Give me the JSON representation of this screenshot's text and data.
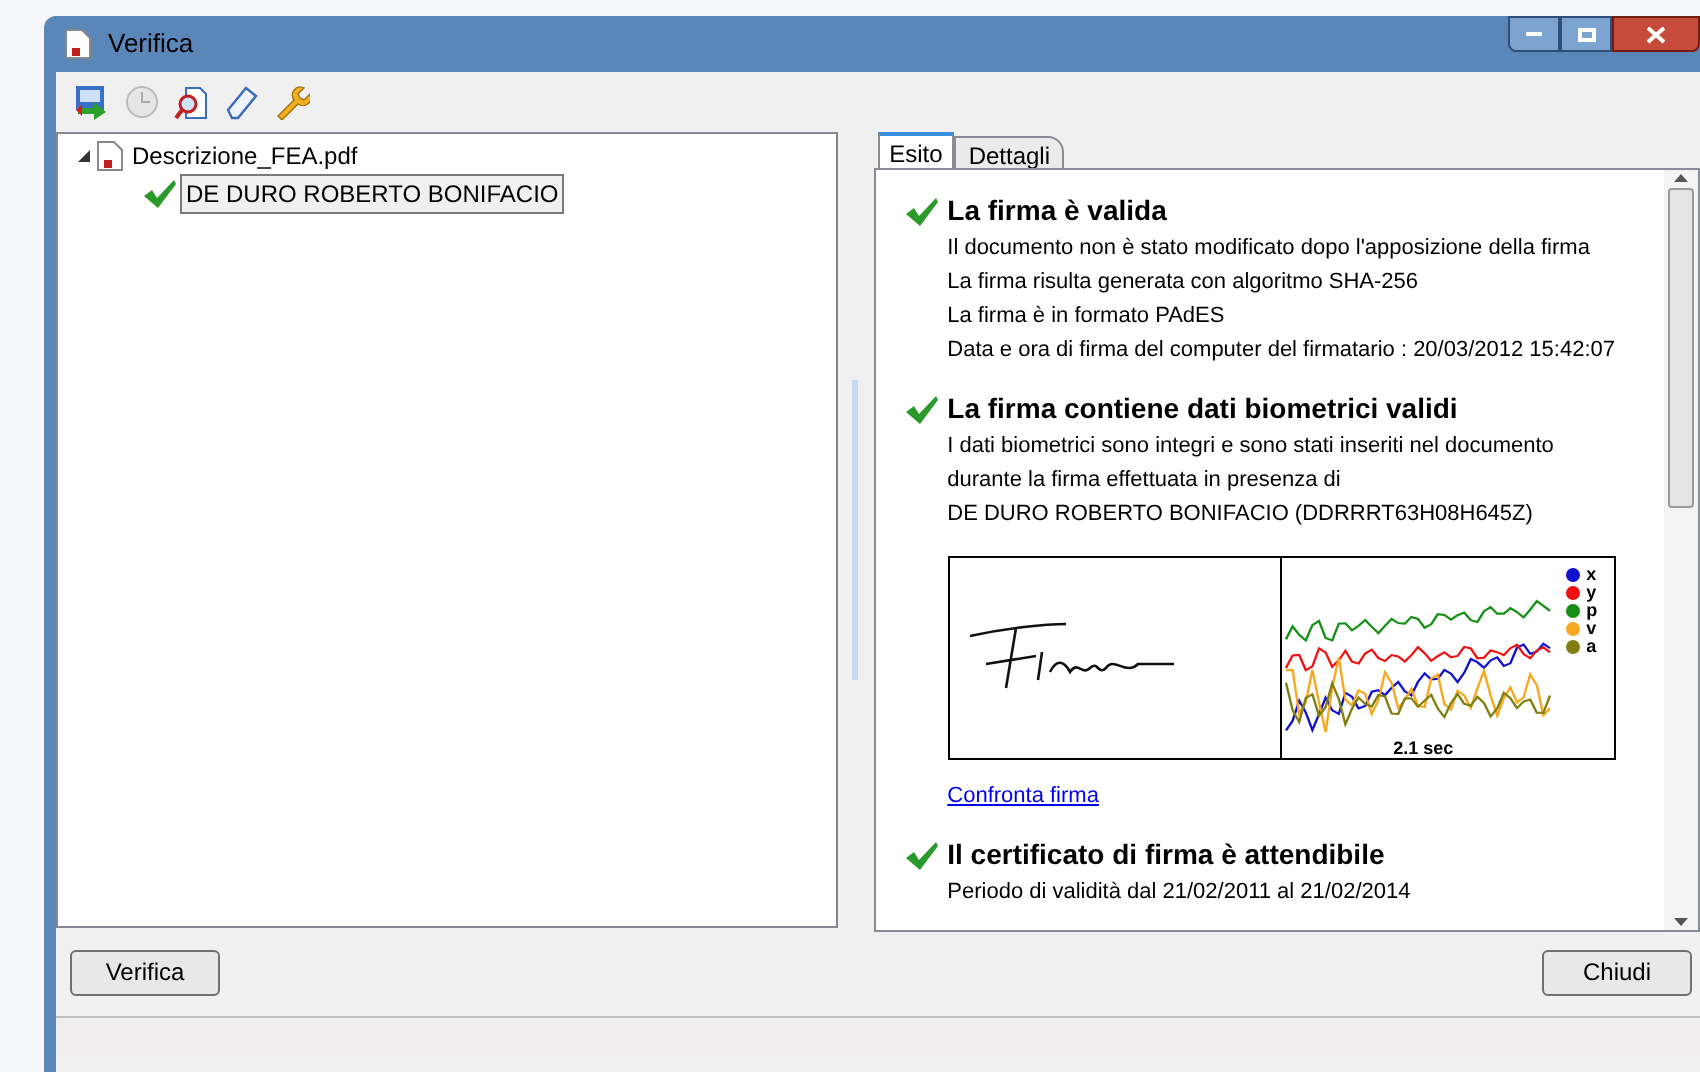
{
  "window": {
    "title": "Verifica"
  },
  "toolbar": [
    {
      "kind": "refresh",
      "disabled": false
    },
    {
      "kind": "clock",
      "disabled": true
    },
    {
      "kind": "inspect",
      "disabled": false
    },
    {
      "kind": "eraser",
      "disabled": false
    },
    {
      "kind": "wrench",
      "disabled": false
    }
  ],
  "tree": [
    {
      "label": "Descrizione_FEA.pdf",
      "expanded": true,
      "children": [
        {
          "label": "DE DURO ROBERTO BONIFACIO",
          "selected": true,
          "valid": true
        }
      ]
    }
  ],
  "tabs": [
    {
      "label": "Esito",
      "selected": true
    },
    {
      "label": "Dettagli",
      "selected": false
    }
  ],
  "sections": [
    {
      "title": "La firma è valida",
      "lines": [
        "Il documento non è stato modificato dopo l'apposizione della firma",
        "La firma risulta generata con algoritmo SHA-256",
        "La firma è in formato PAdES",
        "Data e ora di firma del computer del firmatario : 20/03/2012 15:42:07"
      ]
    },
    {
      "title": "La firma contiene dati biometrici validi",
      "lines": [
        "I dati biometrici sono integri e sono stati inseriti nel documento",
        "durante la firma effettuata in presenza di",
        "DE DURO ROBERTO BONIFACIO (DDRRRT63H08H645Z)"
      ],
      "biometrics": {
        "legend": [
          {
            "label": "x",
            "color": "#1010d0"
          },
          {
            "label": "y",
            "color": "#f01010"
          },
          {
            "label": "p",
            "color": "#159015"
          },
          {
            "label": "v",
            "color": "#f8a820"
          },
          {
            "label": "a",
            "color": "#808010"
          }
        ],
        "duration": "2.1 sec"
      },
      "link": "Confronta firma"
    },
    {
      "title": "Il certificato di firma è attendibile",
      "lines": [
        "Periodo di validità dal 21/02/2011 al 21/02/2014"
      ]
    }
  ],
  "buttons": [
    {
      "label": "Verifica"
    },
    {
      "label": "Chiudi"
    }
  ]
}
